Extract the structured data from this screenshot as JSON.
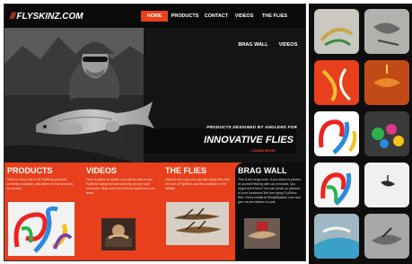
{
  "site": {
    "logo_mark": "///",
    "logo_text": "FLYSKINZ.COM",
    "nav": [
      "HOME",
      "PRODUCTS",
      "CONTACT",
      "VIDEOS",
      "THE FLIES",
      "BRAG WALL",
      "VIDEOS"
    ],
    "nav_active": "HOME"
  },
  "hero": {
    "subtitle": "PRODUCTS DESIGNED BY ANGLERS FOR",
    "title": "INNOVATIVE FLIES",
    "more": "LEARN MORE"
  },
  "panels": [
    {
      "title": "PRODUCTS",
      "blurb": "Click to view a list of all FlySkinz products currently available, and where to buy and how to contact."
    },
    {
      "title": "VIDEOS",
      "blurb": "Here is where to watch, you will be able to see FlySkinz being tied and used by our pro staff members. Stay tuned for more to come from our team."
    },
    {
      "title": "THE FLIES",
      "blurb": "Click to see a pic you can start tying flies with the use of FlySkinz and find material in the details."
    },
    {
      "title": "BRAG WALL",
      "blurb": "This is the brag room. If you send us photos of yourself fishing with our products, you might see it here! You can email us pictures of your creations! We love tying FLySkinz flies. Send emails to flies@flyskinz.com and give us permission to post."
    }
  ],
  "colors": {
    "accent": "#e8401c",
    "background": "#0d0d0d",
    "sidebar": "#0e0e0e"
  }
}
